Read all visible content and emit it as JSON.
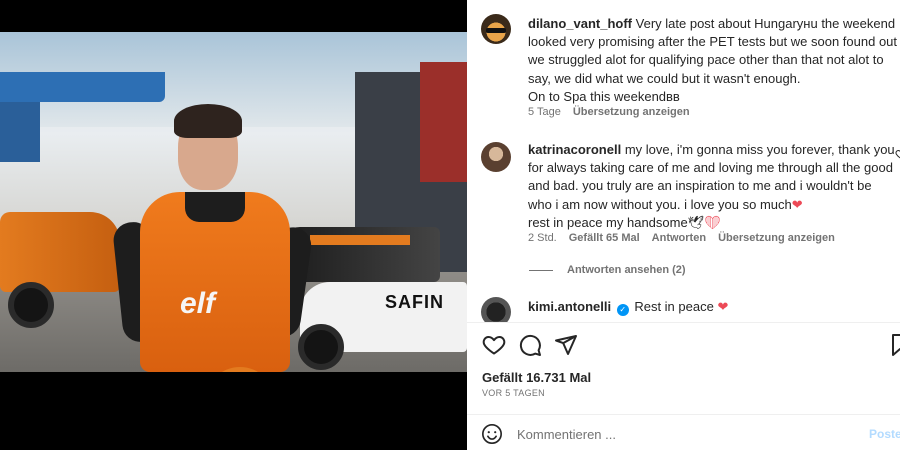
{
  "post": {
    "author": "dilano_vant_hoff",
    "caption": "Very late post about Hungaryнu the weekend looked very promising after the PET tests but we soon found out we struggled alot for qualifying pace other than that not alot to say, we did what we could but it wasn't enough.",
    "caption_line2": "On to Spa this weekendвв",
    "time": "5 Tage",
    "translate": "Übersetzung anzeigen",
    "media_texts": {
      "car_label": "SAFIN",
      "suit_logo": "elf"
    }
  },
  "comments": [
    {
      "username": "katrinacoronell",
      "text": "my love, i'm gonna miss you forever, thank you for always taking care of me and loving me through all the good and bad. you truly are an inspiration to me and i wouldn't be who i am now without you. i love you so much",
      "text_end": "rest in peace my handsome",
      "time": "2 Std.",
      "likes": "Gefällt 65 Mal",
      "reply": "Antworten",
      "translate": "Übersetzung anzeigen",
      "view_replies": "Antworten ansehen (2)"
    },
    {
      "username": "kimi.antonelli",
      "text": "Rest in peace"
    }
  ],
  "actions": {
    "likes_count": "Gefällt 16.731 Mal",
    "date": "VOR 5 TAGEN"
  },
  "add_comment": {
    "placeholder": "Kommentieren ...",
    "post_label": "Posten"
  },
  "colors": {
    "heart": "#ed4956",
    "verified": "#0095f6",
    "post_disabled": "#b3dbff",
    "meta": "#737373"
  }
}
